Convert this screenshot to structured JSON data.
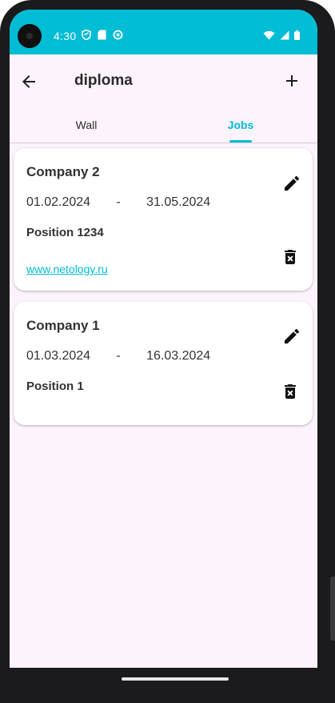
{
  "status_bar": {
    "time": "4:30",
    "icons": [
      "shield-icon",
      "sd-card-icon",
      "sync-icon"
    ],
    "right_icons": [
      "wifi-icon",
      "signal-icon",
      "battery-icon"
    ]
  },
  "app_bar": {
    "title": "diploma",
    "back_icon": "arrow-back-icon",
    "add_icon": "plus-icon"
  },
  "tabs": [
    {
      "label": "Wall",
      "selected": false
    },
    {
      "label": "Jobs",
      "selected": true
    }
  ],
  "colors": {
    "accent": "#00bcd4",
    "background": "#fcf3fc"
  },
  "jobs": [
    {
      "company": "Company 2",
      "start": "01.02.2024",
      "separator": "-",
      "end": "31.05.2024",
      "position": "Position 1234",
      "link": "www.netology.ru"
    },
    {
      "company": "Company 1",
      "start": "01.03.2024",
      "separator": "-",
      "end": "16.03.2024",
      "position": "Position 1"
    }
  ]
}
